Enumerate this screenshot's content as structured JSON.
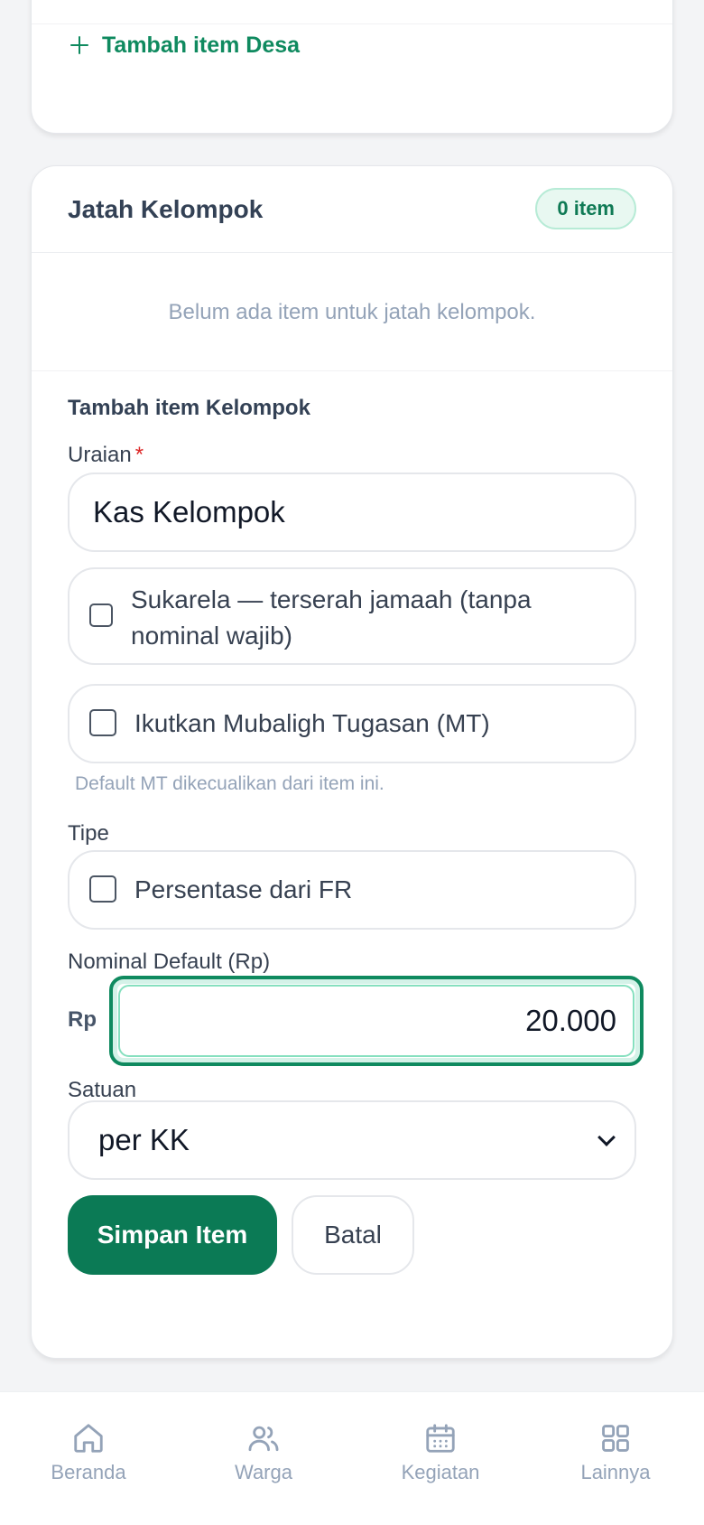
{
  "desa_card": {
    "add_label": "Tambah item Desa"
  },
  "kelompok_card": {
    "title": "Jatah Kelompok",
    "badge": "0 item",
    "empty_text": "Belum ada item untuk jatah kelompok."
  },
  "form": {
    "title": "Tambah item Kelompok",
    "uraian_label": "Uraian",
    "required_mark": "*",
    "uraian_value": "Kas Kelompok",
    "sukarela_label": "Sukarela — terserah jamaah (tanpa nominal wajib)",
    "sukarela_checked": false,
    "mt_label": "Ikutkan Mubaligh Tugasan (MT)",
    "mt_checked": false,
    "mt_hint": "Default MT dikecualikan dari item ini.",
    "tipe_label": "Tipe",
    "persentase_label": "Persentase dari FR",
    "persentase_checked": false,
    "nominal_label": "Nominal Default (Rp)",
    "rp_prefix": "Rp",
    "nominal_value": "20.000",
    "satuan_label": "Satuan",
    "satuan_value": "per KK",
    "save_label": "Simpan Item",
    "cancel_label": "Batal"
  },
  "nav": {
    "items": [
      {
        "label": "Beranda",
        "icon": "home-icon"
      },
      {
        "label": "Warga",
        "icon": "users-icon"
      },
      {
        "label": "Kegiatan",
        "icon": "calendar-icon"
      },
      {
        "label": "Lainnya",
        "icon": "grid-icon"
      }
    ]
  },
  "colors": {
    "accent": "#0f8a5f",
    "primary_button": "#0b7a55",
    "muted": "#94a3b8"
  }
}
